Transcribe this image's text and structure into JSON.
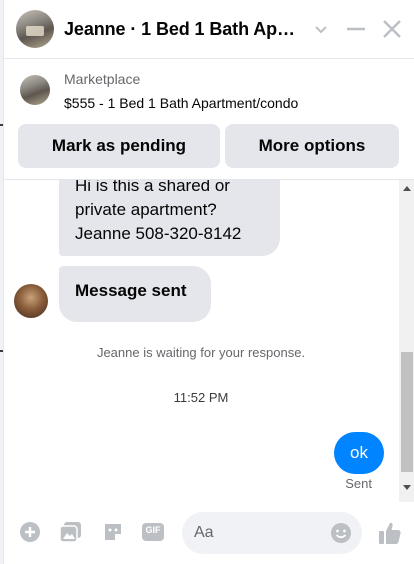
{
  "header": {
    "title": "Jeanne · 1 Bed 1 Bath Apar..."
  },
  "marketplace": {
    "label": "Marketplace",
    "listing": "$555 - 1 Bed 1 Bath Apartment/condo",
    "buttons": {
      "mark_pending": "Mark as pending",
      "more_options": "More options"
    }
  },
  "messages": {
    "incoming": [
      "Hi is this a shared or private apartment? Jeanne 508-320-8142",
      "Message sent"
    ],
    "status": "Jeanne is waiting for your response.",
    "timestamp": "11:52 PM",
    "outgoing": "ok",
    "delivery": "Sent"
  },
  "composer": {
    "placeholder": "Aa",
    "gif_label": "GIF"
  },
  "icons": {
    "header": [
      "avatar",
      "chevron-down-icon",
      "minimize-icon",
      "close-icon"
    ],
    "composer": [
      "plus-icon",
      "photo-icon",
      "sticker-icon",
      "gif-icon",
      "emoji-icon",
      "like-icon"
    ]
  },
  "colors": {
    "accent": "#0084ff",
    "bubble_in": "#e4e6eb",
    "icon_gray": "#bcc0c4"
  }
}
